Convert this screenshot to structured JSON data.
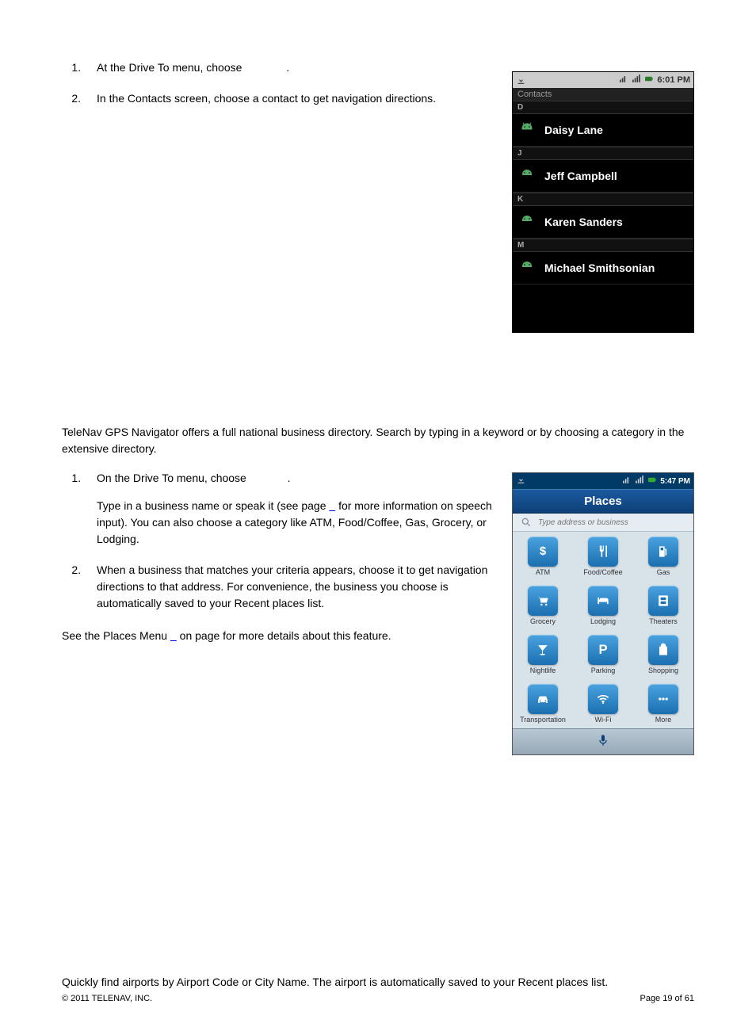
{
  "section1": {
    "step1": "At the Drive To menu, choose",
    "step1_tail": ".",
    "step2": "In the Contacts screen, choose a contact to get navigation directions."
  },
  "contacts_shot": {
    "time": "6:01 PM",
    "title": "Contacts",
    "groups": [
      {
        "letter": "D",
        "name": "Daisy Lane"
      },
      {
        "letter": "J",
        "name": "Jeff Campbell"
      },
      {
        "letter": "K",
        "name": "Karen Sanders"
      },
      {
        "letter": "M",
        "name": "Michael Smithsonian"
      }
    ]
  },
  "section2": {
    "intro": "TeleNav GPS Navigator offers a full national business directory. Search by typing in a keyword or by choosing a category in the extensive directory.",
    "step1_a": "On the Drive To menu, choose",
    "step1_tail": ".",
    "step1_para_a": "Type in a business name or speak it (see page ",
    "step1_para_b": " for more information on speech input). You can also choose a category like ATM, Food/Coffee, Gas, Grocery, or Lodging.",
    "step2": "When a business that matches your criteria appears, choose it to get navigation directions to that address. For convenience, the business you choose is automatically saved to your Recent places list.",
    "see_a": "See the Places Menu ",
    "see_b": " on page  for more details about this feature."
  },
  "places_shot": {
    "time": "5:47 PM",
    "title": "Places",
    "search_ph": "Type address or business",
    "cells": [
      {
        "label": "ATM",
        "icon": "dollar"
      },
      {
        "label": "Food/Coffee",
        "icon": "food"
      },
      {
        "label": "Gas",
        "icon": "gas"
      },
      {
        "label": "Grocery",
        "icon": "cart"
      },
      {
        "label": "Lodging",
        "icon": "bed"
      },
      {
        "label": "Theaters",
        "icon": "film"
      },
      {
        "label": "Nightlife",
        "icon": "martini"
      },
      {
        "label": "Parking",
        "icon": "P"
      },
      {
        "label": "Shopping",
        "icon": "bag"
      },
      {
        "label": "Transportation",
        "icon": "car"
      },
      {
        "label": "Wi-Fi",
        "icon": "wifi"
      },
      {
        "label": "More",
        "icon": "dots"
      }
    ]
  },
  "section3": {
    "text": "Quickly find airports by Airport Code or City Name. The airport is automatically saved to your Recent places list."
  },
  "footer": {
    "copyright": "© 2011 TELENAV, INC.",
    "page": "Page 19 of 61"
  }
}
